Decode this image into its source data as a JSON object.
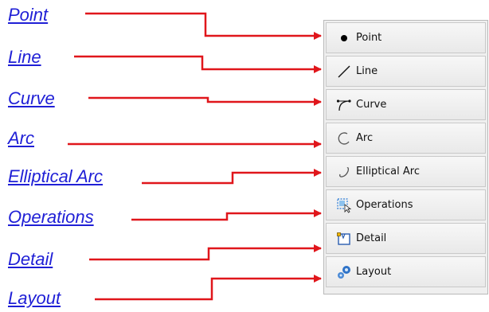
{
  "links": [
    {
      "label": "Point"
    },
    {
      "label": "Line"
    },
    {
      "label": "Curve"
    },
    {
      "label": "Arc"
    },
    {
      "label": "Elliptical Arc"
    },
    {
      "label": "Operations"
    },
    {
      "label": "Detail"
    },
    {
      "label": "Layout"
    }
  ],
  "toolbar": {
    "items": [
      {
        "label": "Point",
        "icon": "point-icon"
      },
      {
        "label": "Line",
        "icon": "line-icon"
      },
      {
        "label": "Curve",
        "icon": "curve-icon"
      },
      {
        "label": "Arc",
        "icon": "arc-icon"
      },
      {
        "label": "Elliptical Arc",
        "icon": "elliptical-arc-icon"
      },
      {
        "label": "Operations",
        "icon": "operations-icon"
      },
      {
        "label": "Detail",
        "icon": "detail-icon"
      },
      {
        "label": "Layout",
        "icon": "layout-icon"
      }
    ]
  },
  "colors": {
    "link": "#1f1fd6",
    "arrow": "#e0161b",
    "toolbar_bg": "#efefef"
  }
}
